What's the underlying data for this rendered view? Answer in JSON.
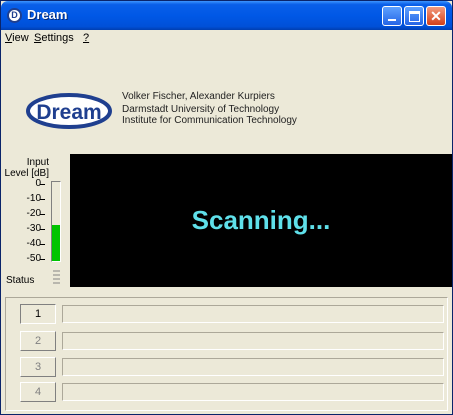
{
  "window": {
    "icon_glyph": "D",
    "title": "Dream"
  },
  "menu": {
    "view": {
      "first": "V",
      "rest": "iew"
    },
    "settings": {
      "first": "S",
      "rest": "ettings"
    },
    "help": {
      "first": "?",
      "rest": ""
    }
  },
  "header": {
    "logo_text": "Dream",
    "authors": "Volker Fischer, Alexander Kurpiers",
    "university": "Darmstadt University of Technology",
    "institute": "Institute for Communication Technology"
  },
  "level_meter": {
    "label_line1": "Input",
    "label_line2": "Level [dB]",
    "ticks": [
      "0",
      "-10",
      "-20",
      "-30",
      "-40",
      "-50"
    ],
    "level_db": -33,
    "status_label": "Status"
  },
  "display": {
    "text": "Scanning..."
  },
  "services": [
    {
      "number": "1",
      "label": "",
      "active": true
    },
    {
      "number": "2",
      "label": "",
      "active": false
    },
    {
      "number": "3",
      "label": "",
      "active": false
    },
    {
      "number": "4",
      "label": "",
      "active": false
    }
  ],
  "colors": {
    "meter_fill": "#00c400",
    "scanning_text": "#5fe0ea",
    "display_bg": "#000000",
    "logo_blue": "#1f3f8f",
    "logo_red": "#cc2a2a"
  }
}
